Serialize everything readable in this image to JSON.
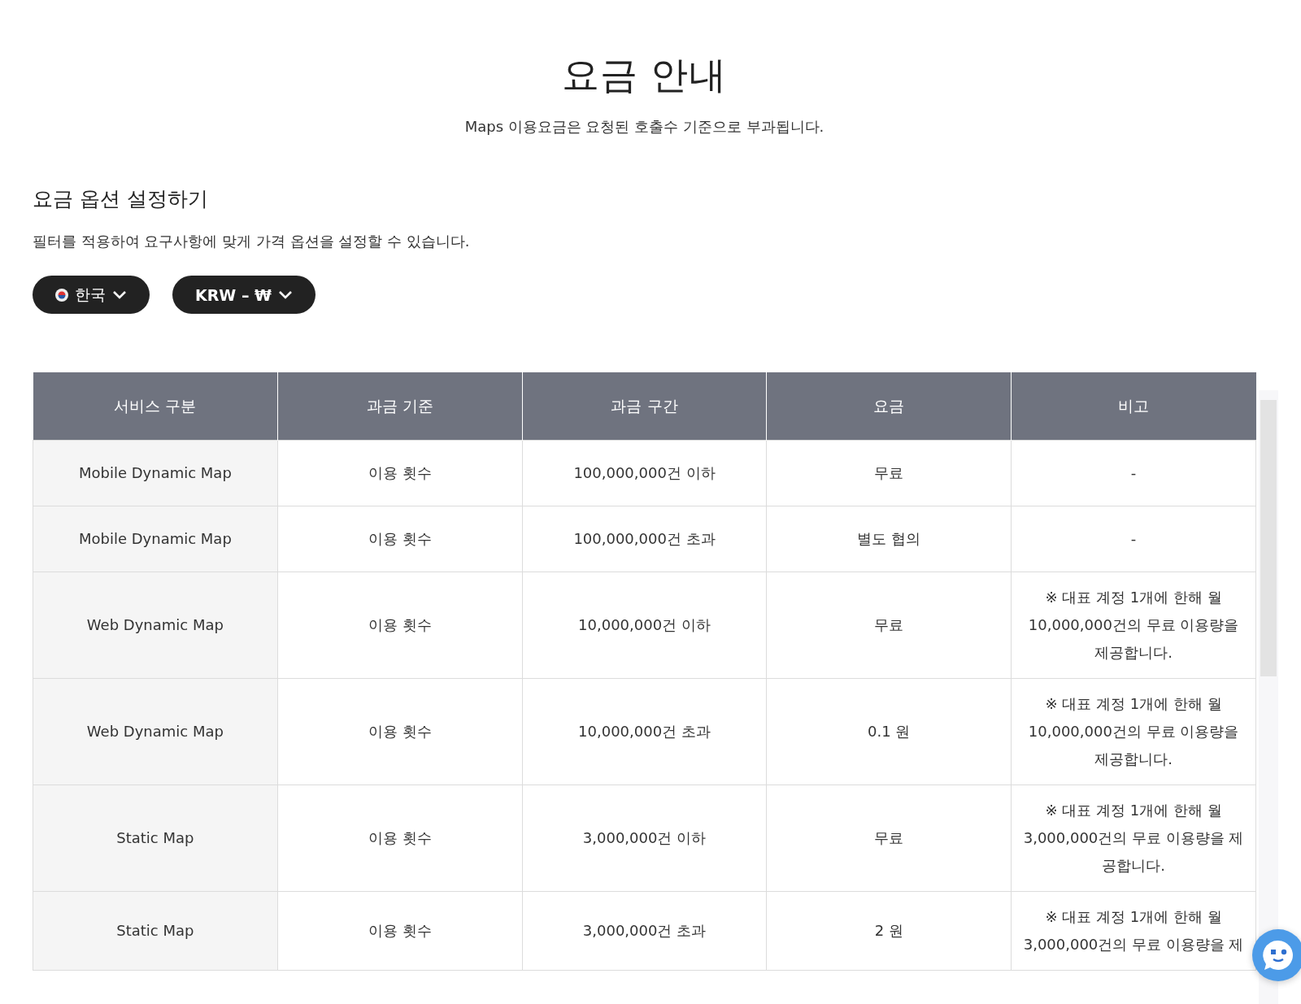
{
  "title": "요금 안내",
  "subtitle": "Maps 이용요금은 요청된 호출수 기준으로 부과됩니다.",
  "options": {
    "heading": "요금 옵션 설정하기",
    "description": "필터를 적용하여 요구사항에 맞게 가격 옵션을 설정할 수 있습니다.",
    "filters": [
      {
        "kind": "country",
        "label": "한국"
      },
      {
        "kind": "currency",
        "label": "KRW – ₩"
      }
    ]
  },
  "table": {
    "columns": [
      "서비스 구분",
      "과금 기준",
      "과금 구간",
      "요금",
      "비고"
    ],
    "rows": [
      {
        "service": "Mobile Dynamic Map",
        "basis": "이용 횟수",
        "range": "100,000,000건 이하",
        "price": "무료",
        "note_lines": [
          "-"
        ]
      },
      {
        "service": "Mobile Dynamic Map",
        "basis": "이용 횟수",
        "range": "100,000,000건 초과",
        "price": "별도 협의",
        "note_lines": [
          "-"
        ]
      },
      {
        "service": "Web Dynamic Map",
        "basis": "이용 횟수",
        "range": "10,000,000건 이하",
        "price": "무료",
        "note_lines": [
          "※ 대표 계정 1개에 한해 월",
          "10,000,000건의 무료 이용량을",
          "제공합니다."
        ]
      },
      {
        "service": "Web Dynamic Map",
        "basis": "이용 횟수",
        "range": "10,000,000건 초과",
        "price": "0.1 원",
        "note_lines": [
          "※ 대표 계정 1개에 한해 월",
          "10,000,000건의 무료 이용량을",
          "제공합니다."
        ]
      },
      {
        "service": "Static Map",
        "basis": "이용 횟수",
        "range": "3,000,000건 이하",
        "price": "무료",
        "note_lines": [
          "※ 대표 계정 1개에 한해 월",
          "3,000,000건의 무료 이용량을 제",
          "공합니다."
        ]
      },
      {
        "service": "Static Map",
        "basis": "이용 횟수",
        "range": "3,000,000건 초과",
        "price": "2 원",
        "note_lines": [
          "※ 대표 계정 1개에 한해 월",
          "3,000,000건의 무료 이용량을 제"
        ]
      }
    ]
  }
}
